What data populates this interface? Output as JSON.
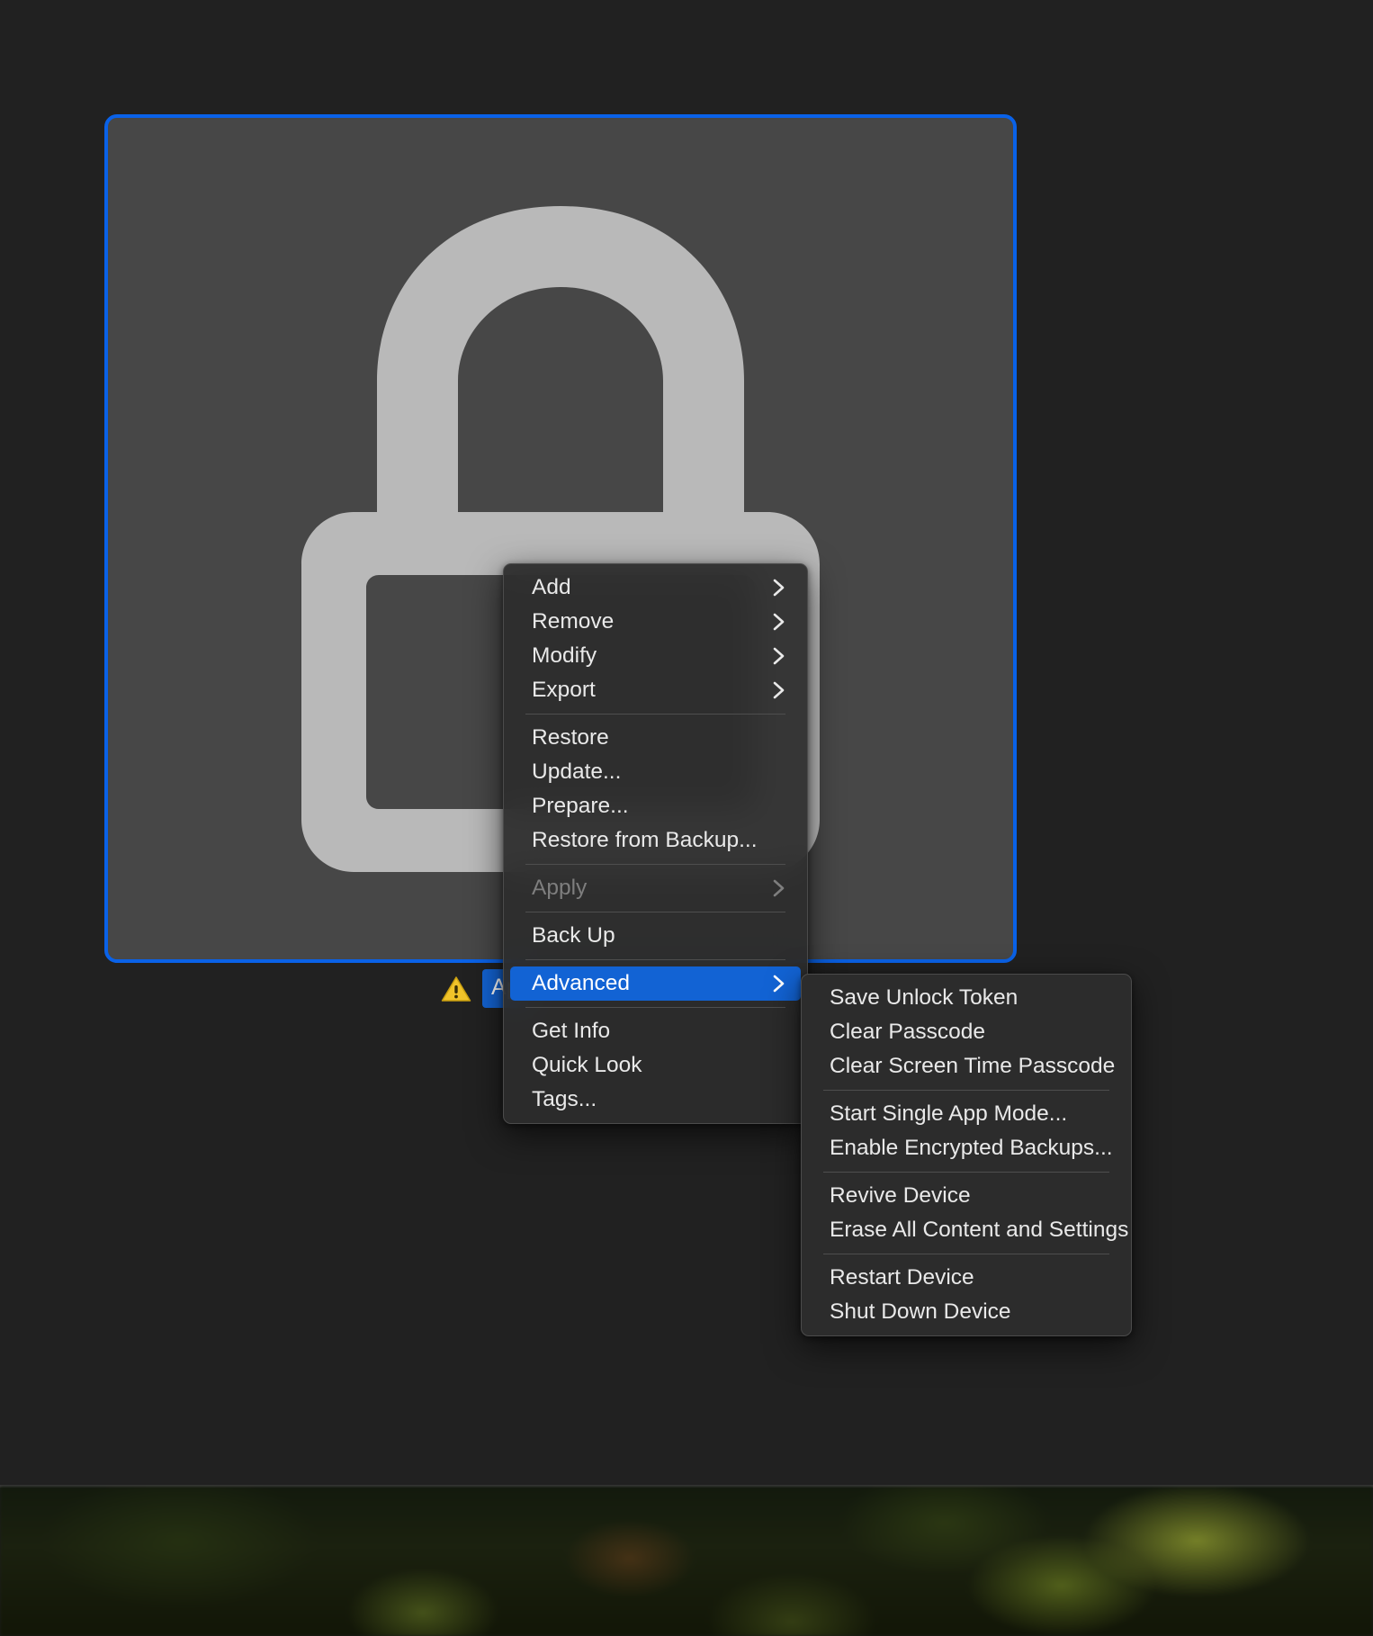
{
  "window": {
    "device_tile": {
      "icon": "lock-icon",
      "selected": true,
      "accent_color": "#0a62e8",
      "tile_background": "#474747",
      "icon_color": "#b9b9b9"
    },
    "status_row": {
      "warning_icon": "warning-triangle-icon",
      "warning_color": "#f0c020",
      "badge_label": "Ap",
      "badge_color": "#1363d2"
    }
  },
  "context_menu": {
    "name": "device-context-menu",
    "groups": [
      {
        "items": [
          {
            "label": "Add",
            "submenu": true,
            "enabled": true,
            "selected": false
          },
          {
            "label": "Remove",
            "submenu": true,
            "enabled": true,
            "selected": false
          },
          {
            "label": "Modify",
            "submenu": true,
            "enabled": true,
            "selected": false
          },
          {
            "label": "Export",
            "submenu": true,
            "enabled": true,
            "selected": false
          }
        ]
      },
      {
        "items": [
          {
            "label": "Restore",
            "submenu": false,
            "enabled": true,
            "selected": false
          },
          {
            "label": "Update...",
            "submenu": false,
            "enabled": true,
            "selected": false
          },
          {
            "label": "Prepare...",
            "submenu": false,
            "enabled": true,
            "selected": false
          },
          {
            "label": "Restore from Backup...",
            "submenu": false,
            "enabled": true,
            "selected": false
          }
        ]
      },
      {
        "items": [
          {
            "label": "Apply",
            "submenu": true,
            "enabled": false,
            "selected": false
          }
        ]
      },
      {
        "items": [
          {
            "label": "Back Up",
            "submenu": false,
            "enabled": true,
            "selected": false
          }
        ]
      },
      {
        "items": [
          {
            "label": "Advanced",
            "submenu": true,
            "enabled": true,
            "selected": true
          }
        ]
      },
      {
        "items": [
          {
            "label": "Get Info",
            "submenu": false,
            "enabled": true,
            "selected": false
          },
          {
            "label": "Quick Look",
            "submenu": false,
            "enabled": true,
            "selected": false
          },
          {
            "label": "Tags...",
            "submenu": false,
            "enabled": true,
            "selected": false
          }
        ]
      }
    ]
  },
  "submenu": {
    "name": "advanced-submenu",
    "parent_item": "Advanced",
    "groups": [
      {
        "items": [
          {
            "label": "Save Unlock Token",
            "submenu": false,
            "enabled": true,
            "selected": false
          },
          {
            "label": "Clear Passcode",
            "submenu": false,
            "enabled": true,
            "selected": false
          },
          {
            "label": "Clear Screen Time Passcode",
            "submenu": false,
            "enabled": true,
            "selected": false
          }
        ]
      },
      {
        "items": [
          {
            "label": "Start Single App Mode...",
            "submenu": false,
            "enabled": true,
            "selected": false
          },
          {
            "label": "Enable Encrypted Backups...",
            "submenu": false,
            "enabled": true,
            "selected": false
          }
        ]
      },
      {
        "items": [
          {
            "label": "Revive Device",
            "submenu": false,
            "enabled": true,
            "selected": false
          },
          {
            "label": "Erase All Content and Settings",
            "submenu": false,
            "enabled": true,
            "selected": false
          }
        ]
      },
      {
        "items": [
          {
            "label": "Restart Device",
            "submenu": false,
            "enabled": true,
            "selected": false
          },
          {
            "label": "Shut Down Device",
            "submenu": false,
            "enabled": true,
            "selected": false
          }
        ]
      }
    ]
  }
}
